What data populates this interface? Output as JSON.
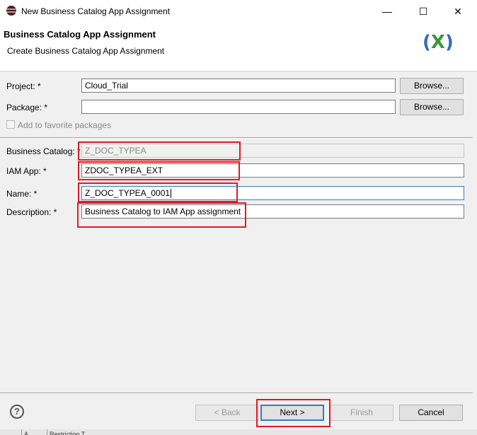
{
  "window": {
    "title": "New Business Catalog App Assignment",
    "minimize_glyph": "—",
    "maximize_glyph": "☐",
    "close_glyph": "✕"
  },
  "header": {
    "title": "Business Catalog App Assignment",
    "subtitle": "Create Business Catalog App Assignment",
    "logo": {
      "open": "(",
      "mark": "X",
      "close": ")"
    }
  },
  "form": {
    "project_label": "Project: *",
    "project_value": "Cloud_Trial",
    "package_label": "Package: *",
    "package_value": "",
    "browse_label": "Browse...",
    "favorite_label": "Add to favorite packages",
    "business_catalog_label": "Business Catalog: *",
    "business_catalog_value": "Z_DOC_TYPEA",
    "iam_app_label": "IAM App: *",
    "iam_app_value": "ZDOC_TYPEA_EXT",
    "name_label": "Name: *",
    "name_value": "Z_DOC_TYPEA_0001",
    "description_label": "Description: *",
    "description_value": "Business Catalog to IAM App assignment"
  },
  "footer": {
    "help_glyph": "?",
    "back_label": "< Back",
    "next_label": "Next >",
    "finish_label": "Finish",
    "cancel_label": "Cancel"
  },
  "statusbar": {
    "items": [
      "",
      "A...",
      "Restriction T..."
    ]
  },
  "colors": {
    "highlight": "#e01b24",
    "focus": "#2f7fc1",
    "background": "#f0f0f0"
  }
}
